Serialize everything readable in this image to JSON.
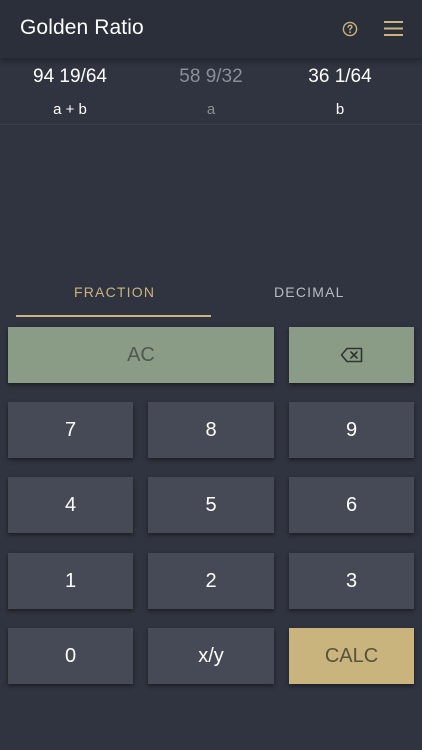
{
  "app": {
    "title": "Golden Ratio"
  },
  "header": {
    "help_icon": "help-circle-icon",
    "menu_icon": "hamburger-menu-icon"
  },
  "results": [
    {
      "value": "94 19/64",
      "label": "a + b"
    },
    {
      "value": "58 9/32",
      "label": "a"
    },
    {
      "value": "36 1/64",
      "label": "b"
    }
  ],
  "tabs": [
    {
      "label": "FRACTION",
      "selected": true
    },
    {
      "label": "DECIMAL",
      "selected": false
    }
  ],
  "keypad": {
    "ac": "AC",
    "backspace_icon": "backspace-icon",
    "k7": "7",
    "k8": "8",
    "k9": "9",
    "k4": "4",
    "k5": "5",
    "k6": "6",
    "k1": "1",
    "k2": "2",
    "k3": "3",
    "k0": "0",
    "fraction": "x/y",
    "calc": "CALC"
  },
  "colors": {
    "background": "#303440",
    "appbar": "#2b2f39",
    "key": "#464a57",
    "accent_gold": "#c8b47c",
    "accent_green": "#8a9c86"
  }
}
